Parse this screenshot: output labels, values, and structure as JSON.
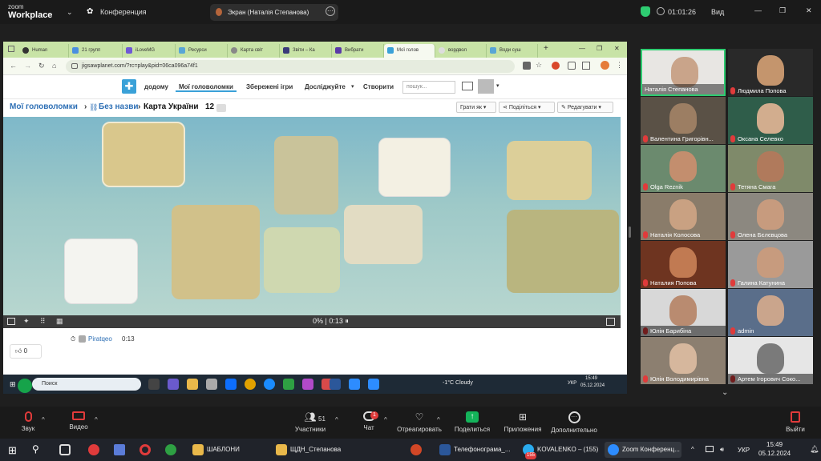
{
  "zoom": {
    "logo_line1": "zoom",
    "logo_line2": "Workplace",
    "meeting_name": "Конференция",
    "share_label": "Экран (Наталія Степанова)",
    "timer": "01:01:26",
    "view_label": "Вид"
  },
  "browser": {
    "tabs": [
      "Human",
      "21 групп",
      "iLoveMG",
      "Ресурси",
      "Карта світ",
      "Звіти – Ка",
      "Вибрати",
      "Мої голов",
      "вордвол",
      "Води суш"
    ],
    "active_tab": 7,
    "url": "jigsawplanet.com/?rc=play&pid=06ca096a74f1"
  },
  "site": {
    "nav": [
      "додому",
      "Мої головоломки",
      "Збережені ігри",
      "Досліджуйте",
      "Створити"
    ],
    "search_placeholder": "пошук...",
    "crumb_root": "Мої головоломки",
    "crumb_mid": "Без назви",
    "crumb_title": "Карта України",
    "crumb_count": "12",
    "btn_play": "Грати як",
    "btn_share": "Поділіться",
    "btn_edit": "Редагувати",
    "progress": "0%",
    "time": "0:13",
    "user": "Piratqeo",
    "user_time": "0:13",
    "likes": "0"
  },
  "shared_taskbar": {
    "search": "Поиск",
    "weather": "-1°C  Cloudy",
    "lang": "УКР",
    "time": "15:49",
    "date": "05.12.2024"
  },
  "participants": [
    "Наталія Степанова",
    "Людмила Попова",
    "Валентина  Григорівн...",
    "Оксана Селевко",
    "Olga Reznik",
    "Тетяна Смага",
    "Наталія Колосова",
    "Олена Бєлєвцова",
    "Наталия Попова",
    "Галина Катунина",
    "Юлія Барибіна",
    "admin",
    "Юлія Володимирівна",
    "Артем Ігорович Соко..."
  ],
  "toolbar": {
    "audio": "Звук",
    "video": "Видео",
    "participants": "Участники",
    "participants_count": "51",
    "chat": "Чат",
    "chat_badge": "1",
    "react": "Отреагировать",
    "share": "Поделиться",
    "apps": "Приложения",
    "more": "Дополнительно",
    "leave": "Выйти"
  },
  "os_taskbar": {
    "apps": [
      "ШАБЛОНИ",
      "ЩДН_Степанова",
      "Телефонограма_...",
      "KOVALENKO – (155)",
      "Zoom Конференц..."
    ],
    "kovalenko_badge": "155",
    "lang": "УКР",
    "time": "15:49",
    "date": "05.12.2024"
  },
  "colors": {
    "zoom_bg": "#1a1a1a",
    "active_speaker": "#2ecc71",
    "share_green": "#14b35a",
    "leave_red": "#e03b3b"
  }
}
